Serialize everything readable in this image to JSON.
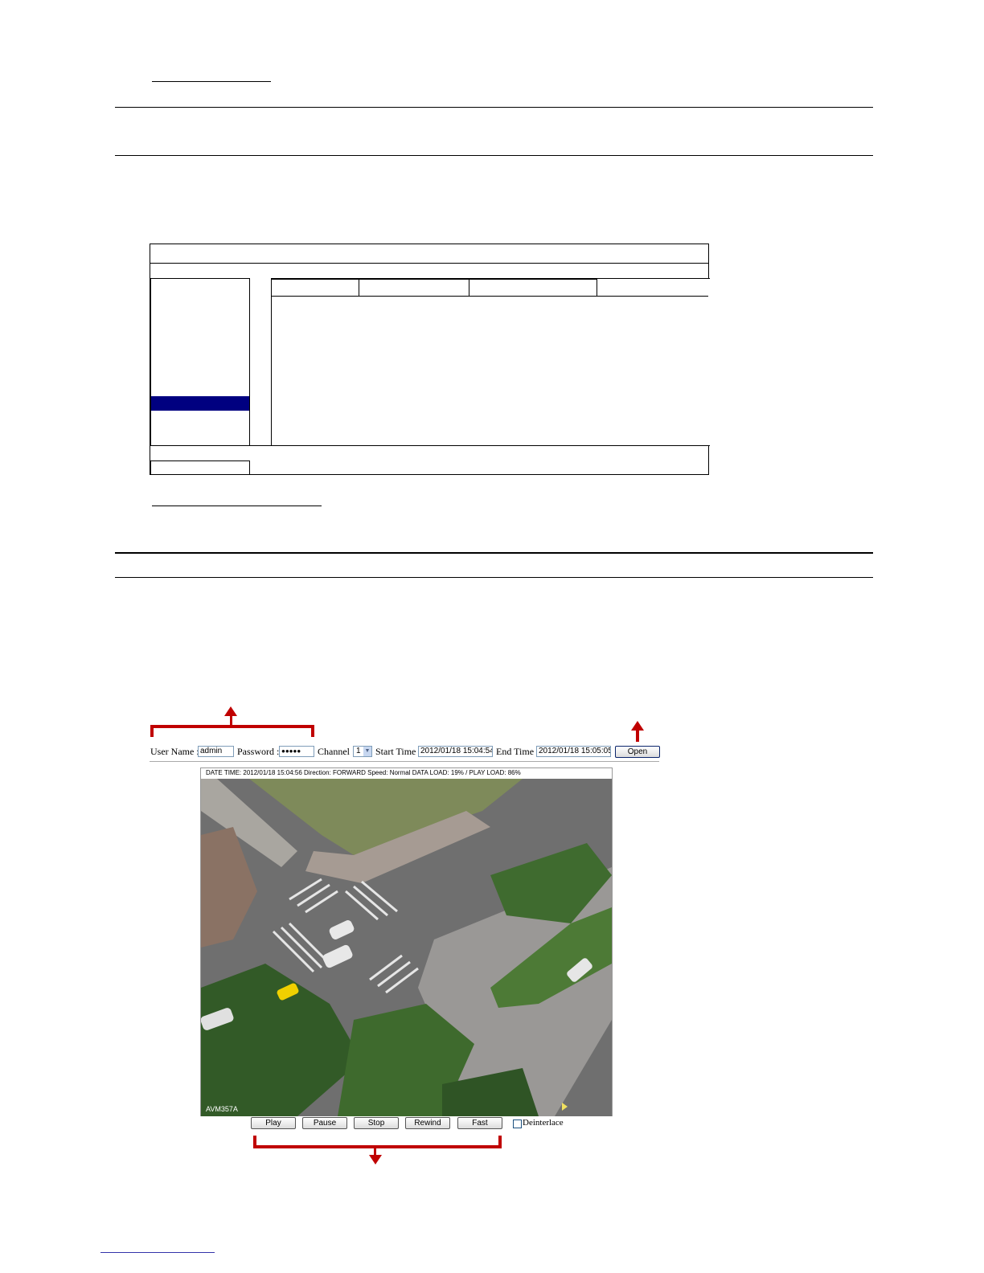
{
  "player": {
    "user_name_label": "User Name :",
    "user_name_value": "admin",
    "password_label": "Password :",
    "password_value": "●●●●●",
    "channel_label": "Channel :",
    "channel_value": "1",
    "start_time_label": "Start Time :",
    "start_time_value": "2012/01/18 15:04:54",
    "end_time_label": "End Time :",
    "end_time_value": "2012/01/18 15:05:05",
    "open_button": "Open",
    "status_line": "DATE TIME: 2012/01/18 15:04:56   Direction: FORWARD  Speed: Normal  DATA LOAD: 19% / PLAY LOAD: 86%",
    "camera_label": "AVM357A",
    "controls": {
      "play": "Play",
      "pause": "Pause",
      "stop": "Stop",
      "rewind": "Rewind",
      "fast": "Fast",
      "deinterlace": "Deinterlace"
    }
  },
  "colors": {
    "annotation_red": "#c00000",
    "selected_row_navy": "#000080"
  }
}
